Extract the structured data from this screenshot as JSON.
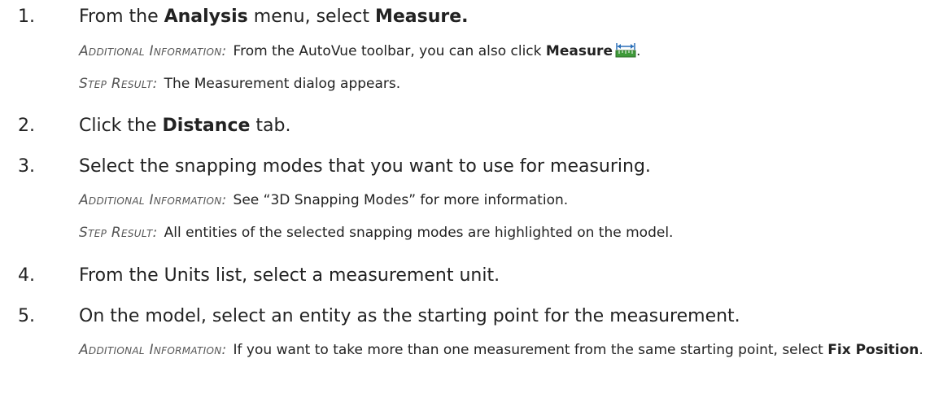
{
  "steps": [
    {
      "number": "1.",
      "text_pre": "From the ",
      "text_b1": "Analysis",
      "text_mid": " menu, select ",
      "text_b2": "Measure.",
      "notes": [
        {
          "label": "Additional Information:",
          "text_pre": "From the AutoVue toolbar, you can also click ",
          "text_b": "Measure",
          "icon": "measure-ruler-icon",
          "text_post": "."
        },
        {
          "label": "Step Result:",
          "text": "The Measurement dialog appears."
        }
      ]
    },
    {
      "number": "2.",
      "text_pre": "Click the ",
      "text_b": "Distance",
      "text_post": " tab."
    },
    {
      "number": "3.",
      "text": "Select the snapping modes that you want to use for measuring.",
      "notes": [
        {
          "label": "Additional Information:",
          "text": "See “3D Snapping Modes” for more information."
        },
        {
          "label": "Step Result:",
          "text": "All entities of the selected snapping modes are highlighted on the model."
        }
      ]
    },
    {
      "number": "4.",
      "text": "From the Units list, select a measurement unit."
    },
    {
      "number": "5.",
      "text": "On the model, select an entity as the starting point for the measurement.",
      "notes": [
        {
          "label": "Additional Information:",
          "text_pre": "If you want to take more than one measurement from the same starting point, select ",
          "text_b": "Fix Position",
          "text_post": "."
        }
      ]
    }
  ],
  "colors": {
    "text": "#222222",
    "label": "#555555",
    "icon_green": "#3f9a3a",
    "icon_blue": "#2a6fb8"
  }
}
